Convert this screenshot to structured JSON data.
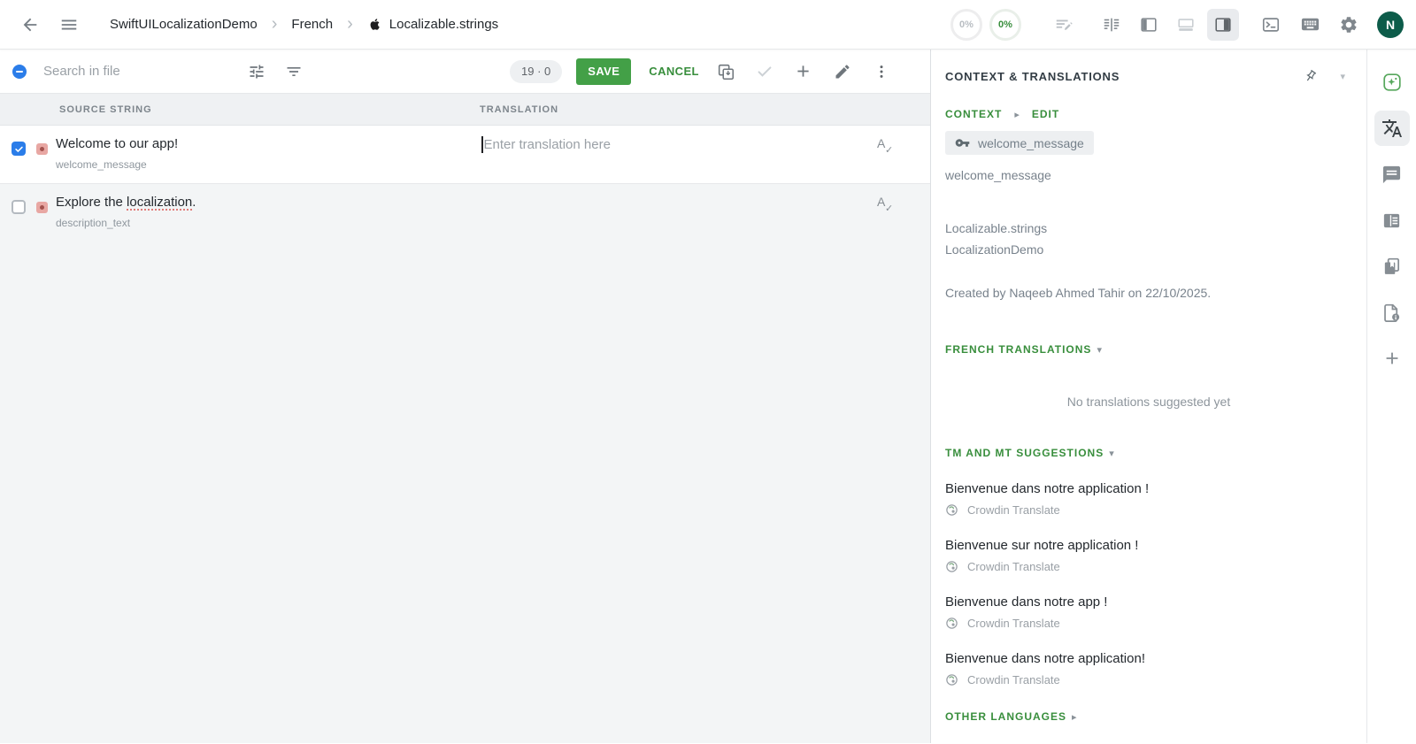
{
  "header": {
    "breadcrumb": {
      "project": "SwiftUILocalizationDemo",
      "language": "French",
      "file": "Localizable.strings"
    },
    "progress_translated": "0%",
    "progress_approved": "0%",
    "avatar_initial": "N"
  },
  "toolbar": {
    "search_placeholder": "Search in file",
    "counter": "19 · 0",
    "save_label": "SAVE",
    "cancel_label": "CANCEL"
  },
  "table": {
    "columns": {
      "source": "SOURCE STRING",
      "translation": "TRANSLATION"
    },
    "rows": [
      {
        "source": "Welcome to our app!",
        "key": "welcome_message",
        "translation_placeholder": "Enter translation here"
      },
      {
        "source_prefix": "Explore the ",
        "source_underline": "localization",
        "source_suffix": ".",
        "key": "description_text"
      }
    ]
  },
  "panel": {
    "title": "CONTEXT & TRANSLATIONS",
    "context_label": "CONTEXT",
    "edit_label": "EDIT",
    "key_chip": "welcome_message",
    "key_name": "welcome_message",
    "file_name": "Localizable.strings",
    "project_name": "LocalizationDemo",
    "created_line": "Created by Naqeeb Ahmed Tahir on 22/10/2025.",
    "french_header": "FRENCH TRANSLATIONS",
    "no_translations": "No translations suggested yet",
    "tm_header": "TM AND MT SUGGESTIONS",
    "suggestions": [
      {
        "text": "Bienvenue dans notre application !",
        "source": "Crowdin Translate"
      },
      {
        "text": "Bienvenue sur notre application !",
        "source": "Crowdin Translate"
      },
      {
        "text": "Bienvenue dans notre app !",
        "source": "Crowdin Translate"
      },
      {
        "text": "Bienvenue dans notre application!",
        "source": "Crowdin Translate"
      }
    ],
    "other_languages": "OTHER LANGUAGES"
  },
  "colors": {
    "accent_green": "#43a047",
    "link_green": "#388e3c",
    "checkbox_blue": "#2b7de9",
    "avatar_green": "#0d5c4a",
    "status_red": "#e8a7a3"
  }
}
